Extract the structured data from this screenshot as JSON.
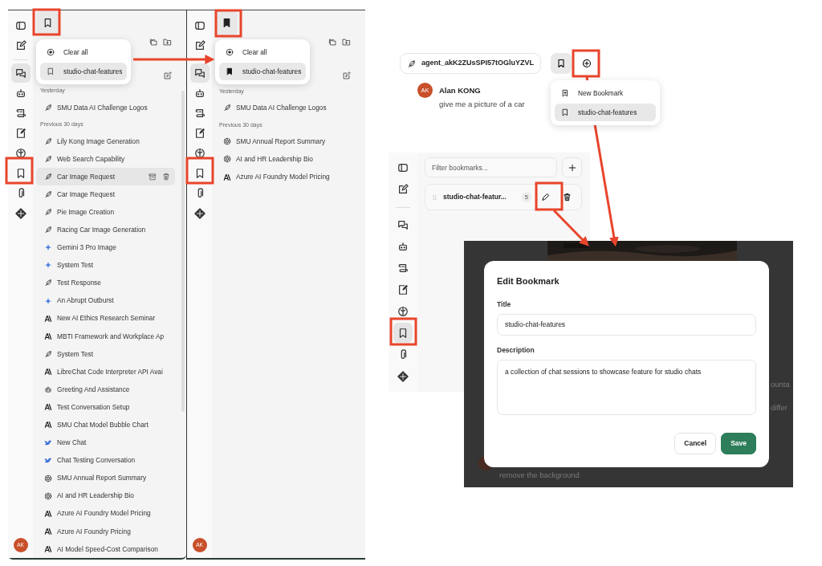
{
  "sidebars": [
    {
      "rail": [
        {
          "kind": "panel",
          "selected": false
        },
        {
          "kind": "compose",
          "selected": false
        },
        {
          "kind": "chats",
          "selected": true
        },
        {
          "kind": "bot",
          "selected": false
        },
        {
          "kind": "scroll",
          "selected": false
        },
        {
          "kind": "note",
          "selected": false
        },
        {
          "kind": "brain",
          "selected": false
        },
        {
          "kind": "bookmark",
          "selected": false
        },
        {
          "kind": "clip",
          "selected": false
        },
        {
          "kind": "diamond",
          "selected": false
        }
      ],
      "filter_active": false,
      "menu": [
        {
          "kind": "clear",
          "label": "Clear all",
          "selected": false
        },
        {
          "kind": "bookmark",
          "label": "studio-chat-features",
          "selected": true,
          "checked": false
        }
      ],
      "groups": [
        {
          "label": "Yesterday",
          "items": [
            {
              "title": "SMU Data AI Challenge Logos",
              "kind": "feather",
              "selected": false
            }
          ]
        },
        {
          "label": "Previous 30 days",
          "items": [
            {
              "title": "Lily Kong Image Generation",
              "kind": "feather",
              "selected": false
            },
            {
              "title": "Web Search Capability",
              "kind": "feather",
              "selected": false
            },
            {
              "title": "Car Image Request",
              "kind": "feather",
              "selected": true
            },
            {
              "title": "Car Image Request",
              "kind": "feather",
              "selected": false
            },
            {
              "title": "Pie Image Creation",
              "kind": "feather",
              "selected": false
            },
            {
              "title": "Racing Car Image Generation",
              "kind": "feather",
              "selected": false
            },
            {
              "title": "Gemini 3 Pro Image",
              "kind": "sparkle",
              "selected": false
            },
            {
              "title": "System Test",
              "kind": "sparkle",
              "selected": false
            },
            {
              "title": "Test Response",
              "kind": "feather",
              "selected": false
            },
            {
              "title": "An Abrupt Outburst",
              "kind": "sparkle",
              "selected": false
            },
            {
              "title": "New AI Ethics Research Seminar",
              "kind": "logo",
              "selected": false
            },
            {
              "title": "MBTI Framework and Workplace Ap",
              "kind": "logo",
              "selected": false
            },
            {
              "title": "System Test",
              "kind": "feather",
              "selected": false
            },
            {
              "title": "LibreChat Code Interpreter API Avai",
              "kind": "logo",
              "selected": false
            },
            {
              "title": "Greeting And Assistance",
              "kind": "bot",
              "selected": false
            },
            {
              "title": "Test Conversation Setup",
              "kind": "logo",
              "selected": false
            },
            {
              "title": "SMU Chat Model Bubble Chart",
              "kind": "logo",
              "selected": false
            },
            {
              "title": "New Chat",
              "kind": "bird",
              "selected": false
            },
            {
              "title": "Chat Testing Conversation",
              "kind": "bird",
              "selected": false
            },
            {
              "title": "SMU Annual Report Summary",
              "kind": "flower",
              "selected": false
            },
            {
              "title": "AI and HR Leadership Bio",
              "kind": "flower",
              "selected": false
            },
            {
              "title": "Azure AI Foundry Model Pricing",
              "kind": "logo",
              "selected": false
            },
            {
              "title": "Azure AI Foundry Pricing",
              "kind": "logo",
              "selected": false
            },
            {
              "title": "AI Model Speed-Cost Comparison",
              "kind": "logo",
              "selected": false
            }
          ]
        }
      ],
      "avatar": "AK"
    },
    {
      "rail": [
        {
          "kind": "panel",
          "selected": false
        },
        {
          "kind": "compose",
          "selected": false
        },
        {
          "kind": "chats",
          "selected": true
        },
        {
          "kind": "bot",
          "selected": false
        },
        {
          "kind": "scroll",
          "selected": false
        },
        {
          "kind": "note",
          "selected": false
        },
        {
          "kind": "brain",
          "selected": false
        },
        {
          "kind": "bookmark",
          "selected": false
        },
        {
          "kind": "clip",
          "selected": false
        },
        {
          "kind": "diamond",
          "selected": false
        }
      ],
      "filter_active": true,
      "menu": [
        {
          "kind": "clear",
          "label": "Clear all",
          "selected": false
        },
        {
          "kind": "bookmark",
          "label": "studio-chat-features",
          "selected": true,
          "checked": true
        }
      ],
      "groups": [
        {
          "label": "Yesterday",
          "items": [
            {
              "title": "SMU Data AI Challenge Logos",
              "kind": "feather",
              "selected": false
            }
          ]
        },
        {
          "label": "Previous 30 days",
          "items": [
            {
              "title": "SMU Annual Report Summary",
              "kind": "flower",
              "selected": false
            },
            {
              "title": "AI and HR Leadership Bio",
              "kind": "flower",
              "selected": false
            },
            {
              "title": "Azure AI Foundry Model Pricing",
              "kind": "logo",
              "selected": false
            }
          ]
        }
      ],
      "avatar": "AK"
    }
  ],
  "chat": {
    "agent": "agent_akK2ZUsSPI57tOGluYZVL",
    "user": {
      "avatar": "AK",
      "name": "Alan KONG",
      "message": "give me a picture of a car"
    },
    "menu": [
      {
        "kind": "new",
        "label": "New Bookmark",
        "selected": false
      },
      {
        "kind": "bookmark",
        "label": "studio-chat-features",
        "selected": true
      }
    ]
  },
  "bookmarks_panel": {
    "rail": [
      {
        "kind": "panel",
        "selected": false
      },
      {
        "kind": "compose",
        "selected": false
      },
      {
        "kind": "chats",
        "selected": false
      },
      {
        "kind": "bot",
        "selected": false
      },
      {
        "kind": "scroll",
        "selected": false
      },
      {
        "kind": "note",
        "selected": false
      },
      {
        "kind": "brain",
        "selected": false
      },
      {
        "kind": "bookmark",
        "selected": true
      },
      {
        "kind": "clip",
        "selected": false
      },
      {
        "kind": "diamond",
        "selected": false
      }
    ],
    "filter": {
      "placeholder": "Filter bookmarks..."
    },
    "rows": [
      {
        "title": "studio-chat-featur...",
        "count": "5"
      }
    ]
  },
  "dialog": {
    "title": "Edit Bookmark",
    "fields": [
      {
        "kind": "input",
        "label": "Title",
        "value": "studio-chat-features"
      },
      {
        "kind": "textarea",
        "label": "Description",
        "value": "a collection of chat sessions to showcase feature for studio chats"
      }
    ],
    "buttons": [
      {
        "kind": "secondary",
        "label": "Cancel"
      },
      {
        "kind": "primary",
        "label": "Save"
      }
    ],
    "background_texts": [
      "ounta",
      "differ",
      "remove the background"
    ]
  }
}
